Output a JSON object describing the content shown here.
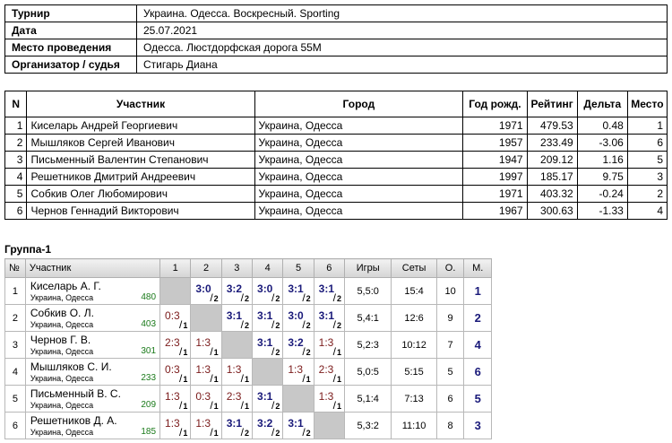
{
  "info": [
    {
      "key": "Турнир",
      "value": "Украина. Одесса. Воскресный. Sporting"
    },
    {
      "key": "Дата",
      "value": "25.07.2021"
    },
    {
      "key": "Место проведения",
      "value": "Одесса. Люстдорфская дорога 55М"
    },
    {
      "key": "Организатор / судья",
      "value": "Стигарь Диана"
    }
  ],
  "participants": {
    "headers": [
      "N",
      "Участник",
      "Город",
      "Год рожд.",
      "Рейтинг",
      "Дельта",
      "Место"
    ],
    "rows": [
      {
        "n": "1",
        "name": "Киселарь Андрей Георгиевич",
        "city": "Украина, Одесса",
        "year": "1971",
        "rating": "479.53",
        "delta": "0.48",
        "place": "1"
      },
      {
        "n": "2",
        "name": "Мышляков Сергей Иванович",
        "city": "Украина, Одесса",
        "year": "1957",
        "rating": "233.49",
        "delta": "-3.06",
        "place": "6"
      },
      {
        "n": "3",
        "name": "Письменный Валентин Степанович",
        "city": "Украина, Одесса",
        "year": "1947",
        "rating": "209.12",
        "delta": "1.16",
        "place": "5"
      },
      {
        "n": "4",
        "name": "Решетников Дмитрий Андреевич",
        "city": "Украина, Одесса",
        "year": "1997",
        "rating": "185.17",
        "delta": "9.75",
        "place": "3"
      },
      {
        "n": "5",
        "name": "Собкив Олег Любомирович",
        "city": "Украина, Одесса",
        "year": "1971",
        "rating": "403.32",
        "delta": "-0.24",
        "place": "2"
      },
      {
        "n": "6",
        "name": "Чернов Геннадий Викторович",
        "city": "Украина, Одесса",
        "year": "1967",
        "rating": "300.63",
        "delta": "-1.33",
        "place": "4"
      }
    ]
  },
  "group": {
    "title": "Группа-1",
    "headers": [
      "№",
      "Участник",
      "1",
      "2",
      "3",
      "4",
      "5",
      "6",
      "Игры",
      "Сеты",
      "О.",
      "М."
    ],
    "rows": [
      {
        "n": "1",
        "name": "Киселарь А. Г.",
        "city": "Украина, Одесса",
        "rating": "480",
        "cells": [
          null,
          {
            "s": "3:0",
            "p": "2",
            "w": true
          },
          {
            "s": "3:2",
            "p": "2",
            "w": true
          },
          {
            "s": "3:0",
            "p": "2",
            "w": true
          },
          {
            "s": "3:1",
            "p": "2",
            "w": true
          },
          {
            "s": "3:1",
            "p": "2",
            "w": true
          }
        ],
        "games": "5,5:0",
        "sets": "15:4",
        "o": "10",
        "m": "1"
      },
      {
        "n": "2",
        "name": "Собкив О. Л.",
        "city": "Украина, Одесса",
        "rating": "403",
        "cells": [
          {
            "s": "0:3",
            "p": "1",
            "w": false
          },
          null,
          {
            "s": "3:1",
            "p": "2",
            "w": true
          },
          {
            "s": "3:1",
            "p": "2",
            "w": true
          },
          {
            "s": "3:0",
            "p": "2",
            "w": true
          },
          {
            "s": "3:1",
            "p": "2",
            "w": true
          }
        ],
        "games": "5,4:1",
        "sets": "12:6",
        "o": "9",
        "m": "2"
      },
      {
        "n": "3",
        "name": "Чернов Г. В.",
        "city": "Украина, Одесса",
        "rating": "301",
        "cells": [
          {
            "s": "2:3",
            "p": "1",
            "w": false
          },
          {
            "s": "1:3",
            "p": "1",
            "w": false
          },
          null,
          {
            "s": "3:1",
            "p": "2",
            "w": true
          },
          {
            "s": "3:2",
            "p": "2",
            "w": true
          },
          {
            "s": "1:3",
            "p": "1",
            "w": false
          }
        ],
        "games": "5,2:3",
        "sets": "10:12",
        "o": "7",
        "m": "4"
      },
      {
        "n": "4",
        "name": "Мышляков С. И.",
        "city": "Украина, Одесса",
        "rating": "233",
        "cells": [
          {
            "s": "0:3",
            "p": "1",
            "w": false
          },
          {
            "s": "1:3",
            "p": "1",
            "w": false
          },
          {
            "s": "1:3",
            "p": "1",
            "w": false
          },
          null,
          {
            "s": "1:3",
            "p": "1",
            "w": false
          },
          {
            "s": "2:3",
            "p": "1",
            "w": false
          }
        ],
        "games": "5,0:5",
        "sets": "5:15",
        "o": "5",
        "m": "6"
      },
      {
        "n": "5",
        "name": "Письменный В. С.",
        "city": "Украина, Одесса",
        "rating": "209",
        "cells": [
          {
            "s": "1:3",
            "p": "1",
            "w": false
          },
          {
            "s": "0:3",
            "p": "1",
            "w": false
          },
          {
            "s": "2:3",
            "p": "1",
            "w": false
          },
          {
            "s": "3:1",
            "p": "2",
            "w": true
          },
          null,
          {
            "s": "1:3",
            "p": "1",
            "w": false
          }
        ],
        "games": "5,1:4",
        "sets": "7:13",
        "o": "6",
        "m": "5"
      },
      {
        "n": "6",
        "name": "Решетников Д. А.",
        "city": "Украина, Одесса",
        "rating": "185",
        "cells": [
          {
            "s": "1:3",
            "p": "1",
            "w": false
          },
          {
            "s": "1:3",
            "p": "1",
            "w": false
          },
          {
            "s": "3:1",
            "p": "2",
            "w": true
          },
          {
            "s": "3:2",
            "p": "2",
            "w": true
          },
          {
            "s": "3:1",
            "p": "2",
            "w": true
          },
          null
        ],
        "games": "5,3:2",
        "sets": "11:10",
        "o": "8",
        "m": "3"
      }
    ]
  }
}
